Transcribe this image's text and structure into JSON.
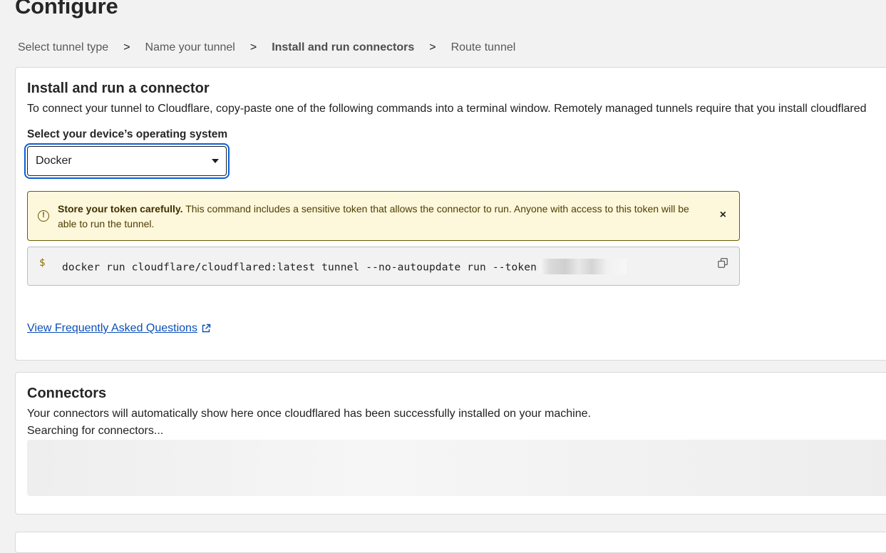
{
  "page": {
    "title": "Configure"
  },
  "steps": [
    {
      "label": "Select tunnel type",
      "active": false
    },
    {
      "label": "Name your tunnel",
      "active": false
    },
    {
      "label": "Install and run connectors",
      "active": true
    },
    {
      "label": "Route tunnel",
      "active": false
    }
  ],
  "step_separator": ">",
  "install": {
    "heading": "Install and run a connector",
    "description": "To connect your tunnel to Cloudflare, copy-paste one of the following commands into a terminal window. Remotely managed tunnels require that you install cloudflared",
    "os_label": "Select your device’s operating system",
    "os_selected": "Docker",
    "alert": {
      "title": "Store your token carefully.",
      "body": "This command includes a sensitive token that allows the connector to run. Anyone with access to this token will be able to run the tunnel.",
      "icon": "warning-circle-icon",
      "close_glyph": "×"
    },
    "command": {
      "prompt": "$",
      "text": "docker run cloudflare/cloudflared:latest tunnel --no-autoupdate run --token",
      "copy_icon": "copy-icon"
    },
    "faq_link": "View Frequently Asked Questions",
    "faq_icon": "external-link-icon"
  },
  "connectors": {
    "heading": "Connectors",
    "description": "Your connectors will automatically show here once cloudflared has been successfully installed on your machine.",
    "status": "Searching for connectors..."
  },
  "colors": {
    "focus_ring": "#0b5fd7",
    "link": "#0b4fb8",
    "alert_bg": "#fdf7dc",
    "alert_border": "#6b5c00"
  }
}
